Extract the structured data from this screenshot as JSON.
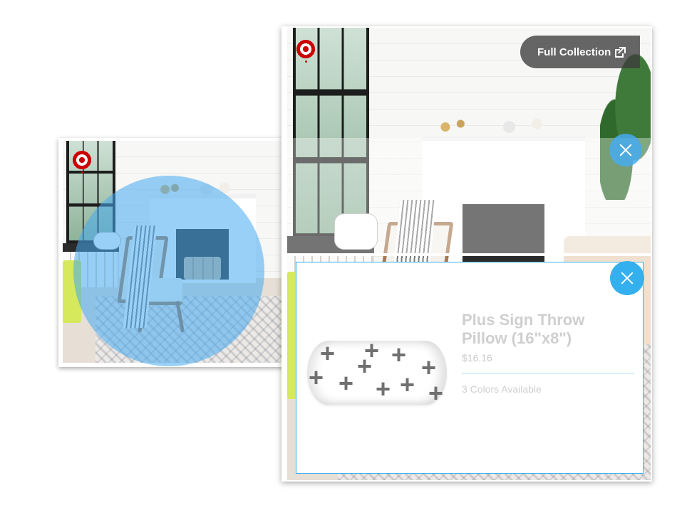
{
  "header": {
    "full_collection_label": "Full Collection"
  },
  "product": {
    "title": "Plus Sign Throw Pillow (16\"x8\")",
    "price": "$16.16",
    "colors_available": "3 Colors Available"
  },
  "icons": {
    "brand": "target-logo",
    "external_link": "external-link-icon",
    "close": "close-icon",
    "hotspot": "hotspot-circle"
  },
  "colors": {
    "brand_red": "#cc0000",
    "accent_blue": "#35b0ee",
    "hotspot_blue": "#46aaf0",
    "dark_pill": "#3c3c3c"
  }
}
